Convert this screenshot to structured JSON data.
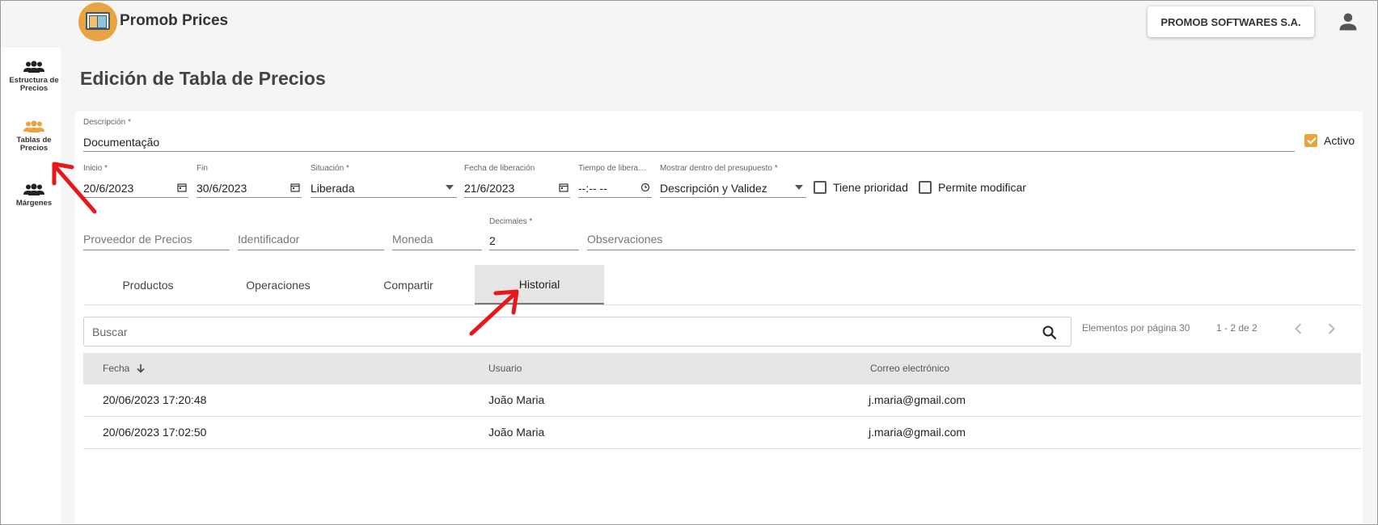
{
  "app": {
    "title": "Promob Prices",
    "company": "PROMOB SOFTWARES S.A."
  },
  "sidebar": {
    "items": [
      {
        "label1": "Estructura de",
        "label2": "Precios",
        "icon": "people-icon"
      },
      {
        "label1": "Tablas de",
        "label2": "Precios",
        "icon": "people-icon",
        "active": true
      },
      {
        "label1": "Márgenes",
        "label2": "",
        "icon": "people-icon"
      }
    ]
  },
  "page": {
    "title": "Edición de Tabla de Precios"
  },
  "form": {
    "descripcion": {
      "label": "Descripción *",
      "value": "Documentação"
    },
    "activo": {
      "label": "Activo",
      "checked": true
    },
    "inicio": {
      "label": "Inicio *",
      "value": "20/6/2023"
    },
    "fin": {
      "label": "Fin",
      "value": "30/6/2023"
    },
    "situacion": {
      "label": "Situación *",
      "value": "Liberada"
    },
    "fecha_liberacion": {
      "label": "Fecha de liberación",
      "value": "21/6/2023"
    },
    "tiempo_liberacion": {
      "label": "Tiempo de libera…",
      "value": "--:-- --"
    },
    "mostrar": {
      "label": "Mostrar dentro del presupuesto *",
      "value": "Descripción y Validez"
    },
    "tiene_prioridad": {
      "label": "Tiene prioridad",
      "checked": false
    },
    "permite_modificar": {
      "label": "Permite modificar",
      "checked": false
    },
    "proveedor": {
      "placeholder": "Proveedor de Precios"
    },
    "identificador": {
      "placeholder": "Identificador"
    },
    "moneda": {
      "placeholder": "Moneda"
    },
    "decimales": {
      "label": "Decimales *",
      "value": "2"
    },
    "observaciones": {
      "placeholder": "Observaciones"
    }
  },
  "tabs": [
    {
      "label": "Productos"
    },
    {
      "label": "Operaciones"
    },
    {
      "label": "Compartir"
    },
    {
      "label": "Historial",
      "active": true
    }
  ],
  "history": {
    "search_placeholder": "Buscar",
    "per_page_label": "Elementos por página 30",
    "range_label": "1 - 2 de 2",
    "columns": [
      "Fecha",
      "Usuario",
      "Correo electrónico"
    ],
    "rows": [
      [
        "20/06/2023 17:20:48",
        "João Maria",
        "j.maria@gmail.com"
      ],
      [
        "20/06/2023 17:02:50",
        "João Maria",
        "j.maria@gmail.com"
      ]
    ]
  },
  "colors": {
    "accent": "#e9a43f",
    "annotation": "#e8181a"
  }
}
